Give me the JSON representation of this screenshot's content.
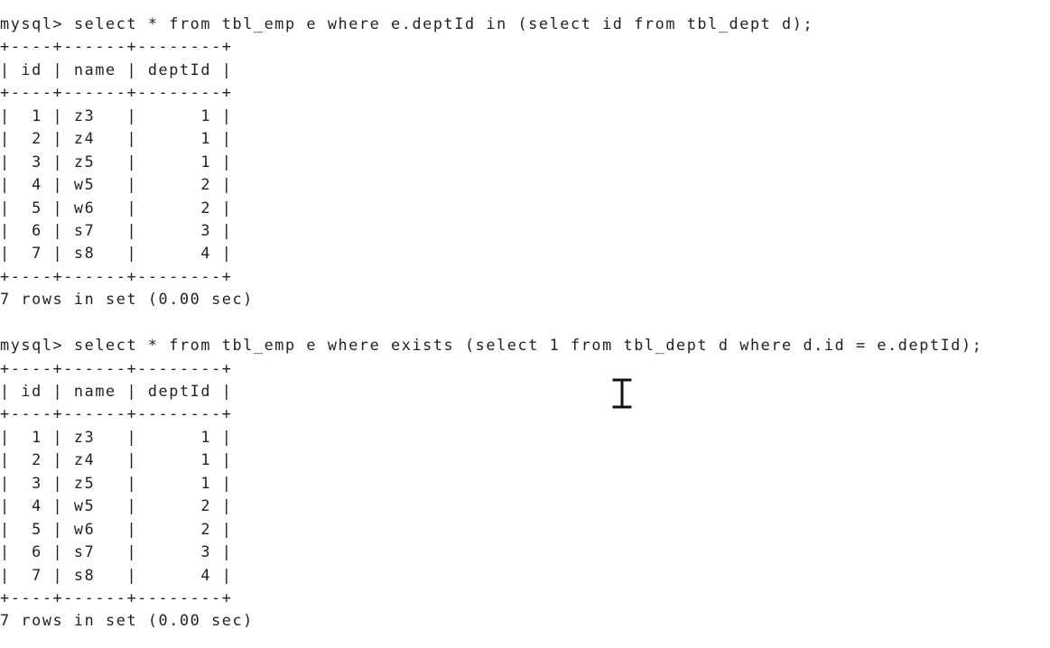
{
  "terminal": {
    "blocks": [
      {
        "prompt": "mysql> ",
        "command": "select * from tbl_emp e where e.deptId in (select id from tbl_dept d);",
        "border": "+----+------+--------+",
        "header_row": "| id | name | deptId |",
        "rows": [
          "|  1 | z3   |      1 |",
          "|  2 | z4   |      1 |",
          "|  3 | z5   |      1 |",
          "|  4 | w5   |      2 |",
          "|  5 | w6   |      2 |",
          "|  6 | s7   |      3 |",
          "|  7 | s8   |      4 |"
        ],
        "summary": "7 rows in set (0.00 sec)"
      },
      {
        "prompt": "mysql> ",
        "command": "select * from tbl_emp e where exists (select 1 from tbl_dept d where d.id = e.deptId);",
        "border": "+----+------+--------+",
        "header_row": "| id | name | deptId |",
        "rows": [
          "|  1 | z3   |      1 |",
          "|  2 | z4   |      1 |",
          "|  3 | z5   |      1 |",
          "|  4 | w5   |      2 |",
          "|  5 | w6   |      2 |",
          "|  6 | s7   |      3 |",
          "|  7 | s8   |      4 |"
        ],
        "summary": "7 rows in set (0.00 sec)"
      }
    ]
  },
  "cursor_icon": "text-cursor-icon"
}
